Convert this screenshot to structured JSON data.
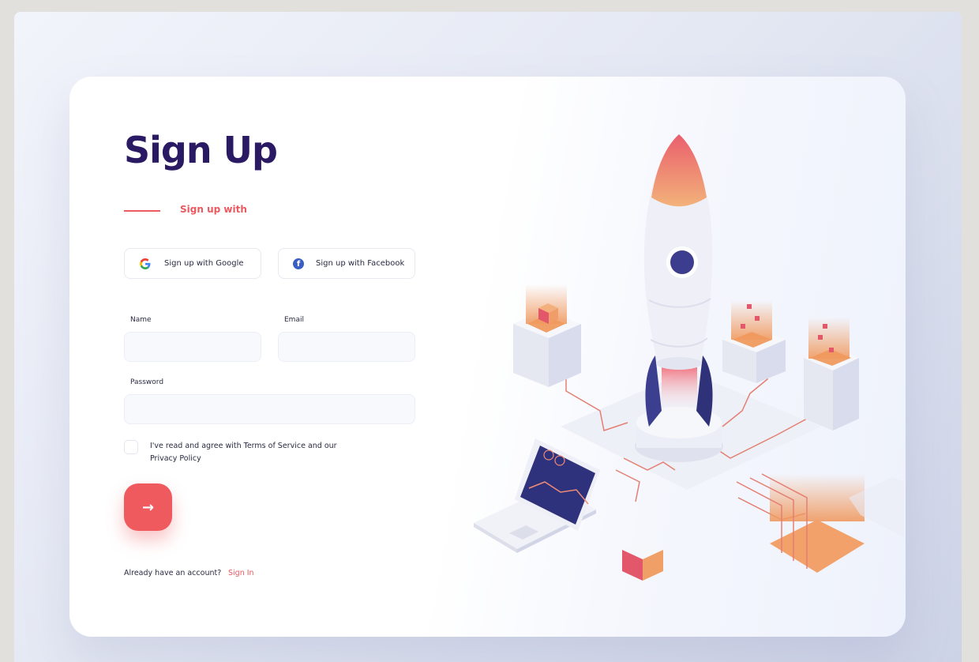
{
  "page": {
    "title": "Sign Up",
    "subtitle": "Sign up with"
  },
  "social": {
    "google_label": "Sign up with Google",
    "facebook_label": "Sign up with Facebook",
    "facebook_glyph": "f"
  },
  "form": {
    "name_label": "Name",
    "email_label": "Email",
    "password_label": "Password",
    "name_value": "",
    "email_value": "",
    "password_value": "",
    "terms_text": "I've read and agree with Terms of Service and our Privacy Policy",
    "terms_checked": false,
    "submit_icon": "→"
  },
  "footer": {
    "have_account": "Already have an account?",
    "sign_in": "Sign In"
  },
  "icons": {
    "google": "google-logo-icon",
    "facebook": "facebook-logo-icon",
    "submit": "arrow-right-icon"
  },
  "colors": {
    "title": "#2a1a63",
    "accent": "#ea5b62",
    "button": "#ef5a5e",
    "facebook": "#3b5ec4"
  }
}
